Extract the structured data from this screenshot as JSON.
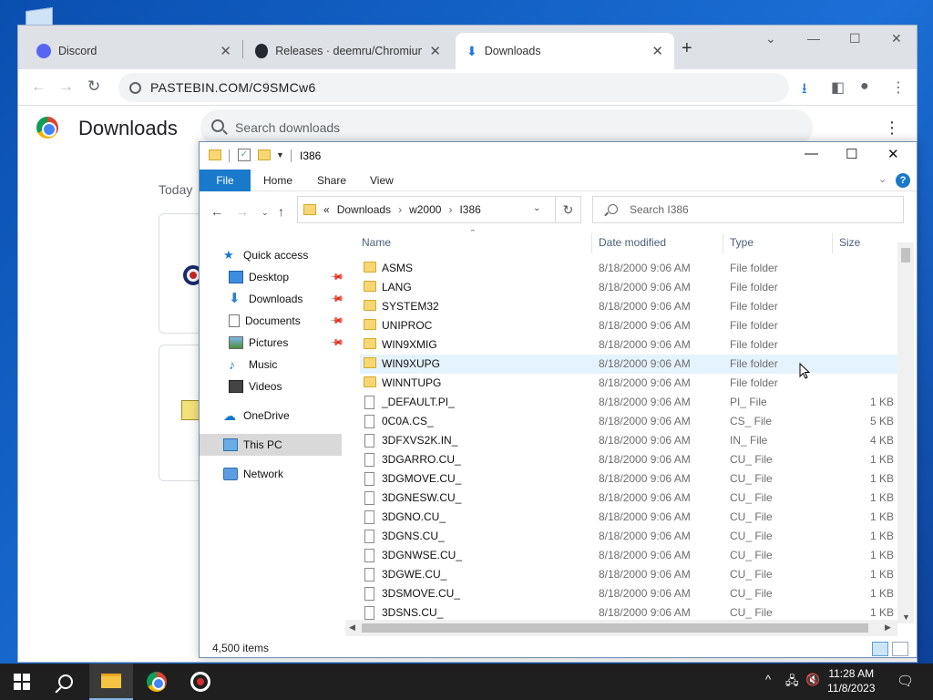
{
  "chrome": {
    "tabs": [
      {
        "label": "Discord",
        "icon": "discord-icon"
      },
      {
        "label": "Releases · deemru/Chromium-G",
        "icon": "github-icon"
      },
      {
        "label": "Downloads",
        "icon": "download-icon"
      }
    ],
    "url": "PASTEBIN.COM/C9SMCw6",
    "page_title": "Downloads",
    "search_placeholder": "Search downloads",
    "section_today": "Today"
  },
  "explorer": {
    "window_title": "I386",
    "ribbon_tabs": [
      "File",
      "Home",
      "Share",
      "View"
    ],
    "breadcrumb": [
      "Downloads",
      "w2000",
      "I386"
    ],
    "breadcrumb_prefix": "«",
    "search_placeholder": "Search I386",
    "columns": [
      "Name",
      "Date modified",
      "Type",
      "Size"
    ],
    "nav": [
      {
        "label": "Quick access",
        "icon": "star-icon"
      },
      {
        "label": "Desktop",
        "icon": "desktop-icon",
        "pinned": true
      },
      {
        "label": "Downloads",
        "icon": "download-arrow-icon",
        "pinned": true
      },
      {
        "label": "Documents",
        "icon": "document-icon",
        "pinned": true
      },
      {
        "label": "Pictures",
        "icon": "pictures-icon",
        "pinned": true
      },
      {
        "label": "Music",
        "icon": "music-icon"
      },
      {
        "label": "Videos",
        "icon": "video-icon"
      },
      {
        "label": "OneDrive",
        "icon": "cloud-icon"
      },
      {
        "label": "This PC",
        "icon": "computer-icon",
        "selected": true
      },
      {
        "label": "Network",
        "icon": "network-icon"
      }
    ],
    "files": [
      {
        "name": "ASMS",
        "date": "8/18/2000 9:06 AM",
        "type": "File folder",
        "size": "",
        "folder": true
      },
      {
        "name": "LANG",
        "date": "8/18/2000 9:06 AM",
        "type": "File folder",
        "size": "",
        "folder": true
      },
      {
        "name": "SYSTEM32",
        "date": "8/18/2000 9:06 AM",
        "type": "File folder",
        "size": "",
        "folder": true
      },
      {
        "name": "UNIPROC",
        "date": "8/18/2000 9:06 AM",
        "type": "File folder",
        "size": "",
        "folder": true
      },
      {
        "name": "WIN9XMIG",
        "date": "8/18/2000 9:06 AM",
        "type": "File folder",
        "size": "",
        "folder": true
      },
      {
        "name": "WIN9XUPG",
        "date": "8/18/2000 9:06 AM",
        "type": "File folder",
        "size": "",
        "folder": true,
        "hover": true
      },
      {
        "name": "WINNTUPG",
        "date": "8/18/2000 9:06 AM",
        "type": "File folder",
        "size": "",
        "folder": true
      },
      {
        "name": "_DEFAULT.PI_",
        "date": "8/18/2000 9:06 AM",
        "type": "PI_ File",
        "size": "1 KB",
        "folder": false
      },
      {
        "name": "0C0A.CS_",
        "date": "8/18/2000 9:06 AM",
        "type": "CS_ File",
        "size": "5 KB",
        "folder": false
      },
      {
        "name": "3DFXVS2K.IN_",
        "date": "8/18/2000 9:06 AM",
        "type": "IN_ File",
        "size": "4 KB",
        "folder": false
      },
      {
        "name": "3DGARRO.CU_",
        "date": "8/18/2000 9:06 AM",
        "type": "CU_ File",
        "size": "1 KB",
        "folder": false
      },
      {
        "name": "3DGMOVE.CU_",
        "date": "8/18/2000 9:06 AM",
        "type": "CU_ File",
        "size": "1 KB",
        "folder": false
      },
      {
        "name": "3DGNESW.CU_",
        "date": "8/18/2000 9:06 AM",
        "type": "CU_ File",
        "size": "1 KB",
        "folder": false
      },
      {
        "name": "3DGNO.CU_",
        "date": "8/18/2000 9:06 AM",
        "type": "CU_ File",
        "size": "1 KB",
        "folder": false
      },
      {
        "name": "3DGNS.CU_",
        "date": "8/18/2000 9:06 AM",
        "type": "CU_ File",
        "size": "1 KB",
        "folder": false
      },
      {
        "name": "3DGNWSE.CU_",
        "date": "8/18/2000 9:06 AM",
        "type": "CU_ File",
        "size": "1 KB",
        "folder": false
      },
      {
        "name": "3DGWE.CU_",
        "date": "8/18/2000 9:06 AM",
        "type": "CU_ File",
        "size": "1 KB",
        "folder": false
      },
      {
        "name": "3DSMOVE.CU_",
        "date": "8/18/2000 9:06 AM",
        "type": "CU_ File",
        "size": "1 KB",
        "folder": false
      },
      {
        "name": "3DSNS.CU_",
        "date": "8/18/2000 9:06 AM",
        "type": "CU_ File",
        "size": "1 KB",
        "folder": false
      }
    ],
    "status": "4,500 items"
  },
  "taskbar": {
    "time": "11:28 AM",
    "date": "11/8/2023"
  },
  "colors": {
    "ribbon_file": "#1979ca",
    "desktop": "#1b6fd6",
    "taskbar": "#1f1f1f"
  }
}
